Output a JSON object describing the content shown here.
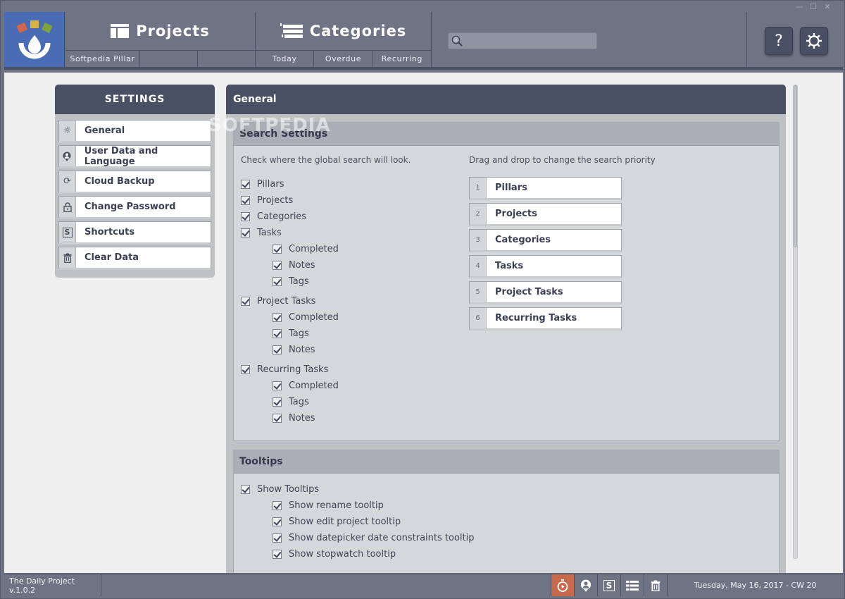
{
  "window": {
    "controls": [
      "minimize",
      "maximize",
      "close"
    ]
  },
  "header": {
    "logo": "app-logo",
    "nav": [
      {
        "title": "Projects",
        "icon": "projects-icon",
        "subtabs": [
          "Softpedia Pillar",
          "",
          ""
        ]
      },
      {
        "title": "Categories",
        "icon": "categories-icon",
        "subtabs": [
          "Today",
          "Overdue",
          "Recurring"
        ]
      }
    ],
    "search": {
      "value": "",
      "placeholder": ""
    },
    "help_label": "?",
    "settings_icon": "gear-icon"
  },
  "sidebar": {
    "title": "SETTINGS",
    "items": [
      {
        "label": "General",
        "icon": "gear-icon"
      },
      {
        "label": "User Data and Language",
        "icon": "user-pin-icon"
      },
      {
        "label": "Cloud Backup",
        "icon": "sync-icon"
      },
      {
        "label": "Change Password",
        "icon": "lock-icon"
      },
      {
        "label": "Shortcuts",
        "icon": "shortcut-s-icon"
      },
      {
        "label": "Clear Data",
        "icon": "trash-icon"
      }
    ]
  },
  "main": {
    "title": "General",
    "watermark": "SOFTPEDIA",
    "search_settings": {
      "title": "Search Settings",
      "left_hint": "Check where the global search will look.",
      "right_hint": "Drag and drop to change the search priority",
      "checks": [
        {
          "label": "Pillars",
          "checked": true,
          "level": 0
        },
        {
          "label": "Projects",
          "checked": true,
          "level": 0
        },
        {
          "label": "Categories",
          "checked": true,
          "level": 0
        },
        {
          "label": "Tasks",
          "checked": true,
          "level": 0
        },
        {
          "label": "Completed",
          "checked": true,
          "level": 1
        },
        {
          "label": "Notes",
          "checked": true,
          "level": 1
        },
        {
          "label": "Tags",
          "checked": true,
          "level": 1
        },
        {
          "label": "Project Tasks",
          "checked": true,
          "level": 0
        },
        {
          "label": "Completed",
          "checked": true,
          "level": 1
        },
        {
          "label": "Tags",
          "checked": true,
          "level": 1
        },
        {
          "label": "Notes",
          "checked": true,
          "level": 1
        },
        {
          "label": "Recurring Tasks",
          "checked": true,
          "level": 0
        },
        {
          "label": "Completed",
          "checked": true,
          "level": 1
        },
        {
          "label": "Tags",
          "checked": true,
          "level": 1
        },
        {
          "label": "Notes",
          "checked": true,
          "level": 1
        }
      ],
      "priority": [
        {
          "num": "1",
          "label": "Pillars"
        },
        {
          "num": "2",
          "label": "Projects"
        },
        {
          "num": "3",
          "label": "Categories"
        },
        {
          "num": "4",
          "label": "Tasks"
        },
        {
          "num": "5",
          "label": "Project Tasks"
        },
        {
          "num": "6",
          "label": "Recurring Tasks"
        }
      ]
    },
    "tooltips": {
      "title": "Tooltips",
      "checks": [
        {
          "label": "Show Tooltips",
          "checked": true,
          "level": 0
        },
        {
          "label": "Show rename tooltip",
          "checked": true,
          "level": 1
        },
        {
          "label": "Show edit project tooltip",
          "checked": true,
          "level": 1
        },
        {
          "label": "Show datepicker date constraints tooltip",
          "checked": true,
          "level": 1
        },
        {
          "label": "Show stopwatch tooltip",
          "checked": true,
          "level": 1
        }
      ]
    }
  },
  "statusbar": {
    "version": "The Daily Project v.1.0.2",
    "icons": [
      "stopwatch-icon",
      "user-pin-icon",
      "shortcut-s-icon",
      "categories-icon",
      "trash-icon"
    ],
    "date": "Tuesday, May 16, 2017 - CW 20"
  },
  "colors": {
    "accent_blue": "#4a6cb5",
    "dark_header": "#4a5063",
    "chrome": "#6f7485",
    "stopwatch_active": "#c8694b"
  }
}
